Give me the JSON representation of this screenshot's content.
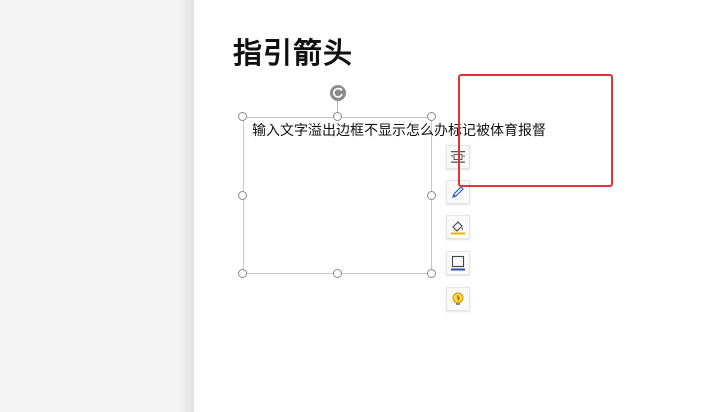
{
  "document": {
    "heading": "指引箭头",
    "textbox_text": "输入文字溢出边框不显示怎么办标记被体育报督"
  },
  "floating_toolbar": {
    "tools": [
      {
        "icon": "text-wrap-icon"
      },
      {
        "icon": "shape-edit-icon"
      },
      {
        "icon": "fill-color-icon"
      },
      {
        "icon": "border-outline-icon"
      },
      {
        "icon": "smart-tips-icon"
      }
    ]
  },
  "colors": {
    "highlight": "#e0343a",
    "accent_blue": "#2f5fc8",
    "accent_yellow": "#e8b400"
  }
}
